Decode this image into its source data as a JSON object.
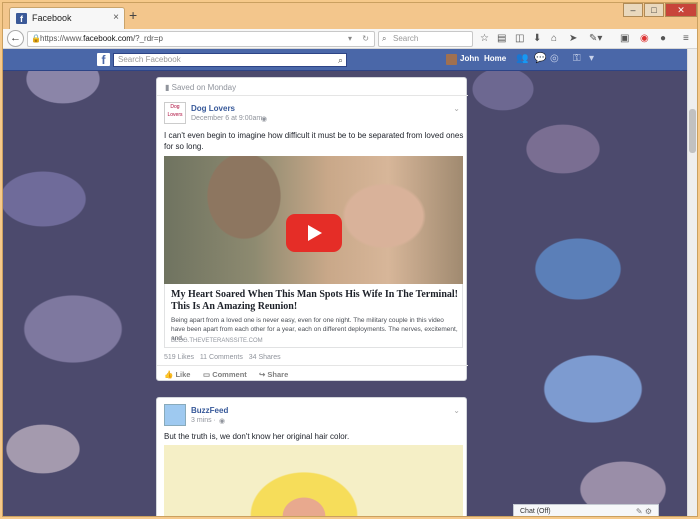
{
  "browser": {
    "tab_title": "Facebook",
    "tab_close": "×",
    "new_tab": "+",
    "url_prefix": "https://www.",
    "url_host": "facebook.com",
    "url_path": "/?_rdr=p",
    "search_placeholder": "Search"
  },
  "fb": {
    "search_placeholder": "Search Facebook",
    "user_name": "John",
    "home_label": "Home"
  },
  "post1": {
    "saved_label": "Saved on Monday",
    "page_name": "Dog Lovers",
    "avatar_text": "Dog Lovers",
    "meta": "December 6 at 9:00am ·",
    "text": "I can't even begin to imagine how difficult it must be to be separated from loved ones for so long.",
    "link_title": "My Heart Soared When This Man Spots His Wife In The Terminal! This Is An Amazing Reunion!",
    "link_desc": "Being apart from a loved one is never easy, even for one night. The military couple in this video have been apart from each other for a year, each on different deployments. The nerves, excitement, and...",
    "link_domain": "BLOG.THEVETERANSSITE.COM",
    "likes": "519 Likes",
    "comments": "11 Comments",
    "shares": "34 Shares",
    "like_label": "Like",
    "comment_label": "Comment",
    "share_label": "Share"
  },
  "post2": {
    "page_name": "BuzzFeed",
    "meta": "3 mins ·",
    "text": "But the truth is, we don't know her original hair color."
  },
  "chat": {
    "label": "Chat (Off)"
  },
  "colors": {
    "fb_blue": "#4a67a8",
    "link_blue": "#365899",
    "youtube_red": "#e52d27"
  }
}
